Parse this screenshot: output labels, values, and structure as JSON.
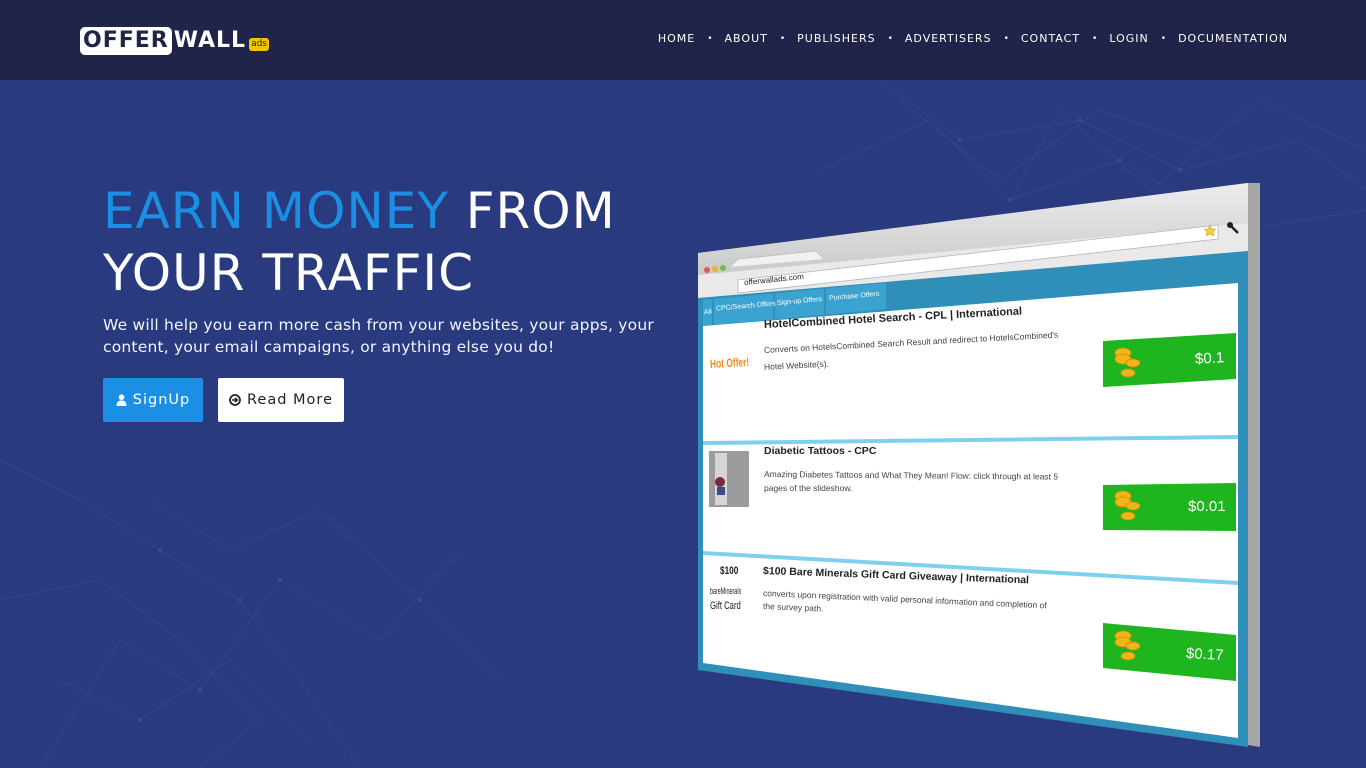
{
  "brand": {
    "name_part1": "OFFER",
    "name_part2": "WALL",
    "badge": "ads"
  },
  "nav": {
    "items": [
      {
        "label": "HOME"
      },
      {
        "label": "ABOUT"
      },
      {
        "label": "PUBLISHERS"
      },
      {
        "label": "ADVERTISERS"
      },
      {
        "label": "CONTACT"
      },
      {
        "label": "LOGIN"
      },
      {
        "label": "DOCUMENTATION"
      }
    ],
    "separator": "•"
  },
  "hero": {
    "title_accent": "EARN MONEY",
    "title_rest_line1": "FROM",
    "title_line2": "YOUR TRAFFIC",
    "description": "We will help you earn more cash from your websites, your apps, your content, your email campaigns, or anything else you do!",
    "signup_label": "SignUp",
    "read_more_label": "Read More"
  },
  "colors": {
    "navbar_bg": "#1f2448",
    "hero_bg": "#2a3a7e",
    "accent": "#1a8fe3",
    "offer_tab_bg": "#2f8fb8",
    "payout_green": "#1fb51f"
  },
  "mockup": {
    "url": "offerwallads.com",
    "tabs": [
      {
        "label": "All"
      },
      {
        "label": "CPC/Search Offers"
      },
      {
        "label": "Sign-up Offers"
      },
      {
        "label": "Purchase Offers"
      }
    ],
    "offers": [
      {
        "thumb": "Hot Offer!",
        "title": "HotelCombined Hotel Search - CPL | International",
        "desc_line1": "Converts on HotelsCombined Search Result and redirect to HotelsCombined's",
        "desc_line2": "Hotel Website(s).",
        "payout": "$0.1"
      },
      {
        "thumb": "tattoo-photo",
        "title": "Diabetic Tattoos - CPC",
        "desc_line1": "Amazing Diabetes Tattoos and What They Mean! Flow: click through at least 5",
        "desc_line2": "pages of the slideshow.",
        "payout": "$0.01"
      },
      {
        "thumb_line1": "$100",
        "thumb_line2": "bareMinerals",
        "thumb_line3": "Gift Card",
        "title": "$100 Bare Minerals Gift Card Giveaway | International",
        "desc_line1": "converts upon registration with valid personal information and completion of",
        "desc_line2": "the survey path.",
        "payout": "$0.17"
      }
    ]
  }
}
